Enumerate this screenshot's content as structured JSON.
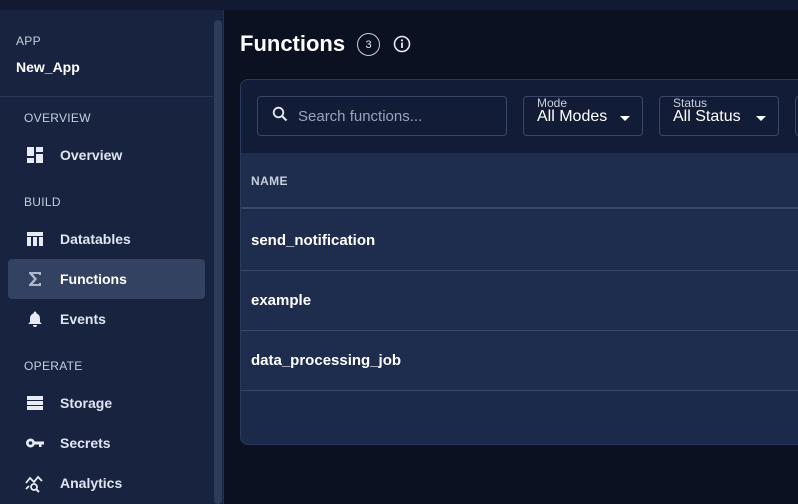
{
  "sidebar": {
    "app_label": "APP",
    "app_name": "New_App",
    "sections": {
      "overview": "OVERVIEW",
      "build": "BUILD",
      "operate": "OPERATE"
    },
    "items": [
      {
        "label": "Overview",
        "icon": "dashboard-icon"
      },
      {
        "label": "Datatables",
        "icon": "table-icon"
      },
      {
        "label": "Functions",
        "icon": "sigma-icon",
        "active": true
      },
      {
        "label": "Events",
        "icon": "bell-icon"
      },
      {
        "label": "Storage",
        "icon": "storage-icon"
      },
      {
        "label": "Secrets",
        "icon": "key-icon"
      },
      {
        "label": "Analytics",
        "icon": "analytics-icon"
      }
    ]
  },
  "header": {
    "title": "Functions",
    "count": "3"
  },
  "toolbar": {
    "search_placeholder": "Search functions...",
    "mode": {
      "label": "Mode",
      "value": "All Modes"
    },
    "status": {
      "label": "Status",
      "value": "All Status"
    }
  },
  "table": {
    "columns": [
      "NAME"
    ],
    "rows": [
      "send_notification",
      "example",
      "data_processing_job"
    ]
  },
  "colors": {
    "background": "#0b1121",
    "sidebar": "#17233f",
    "active_item": "#324260",
    "panel": "#1b2a4a"
  }
}
